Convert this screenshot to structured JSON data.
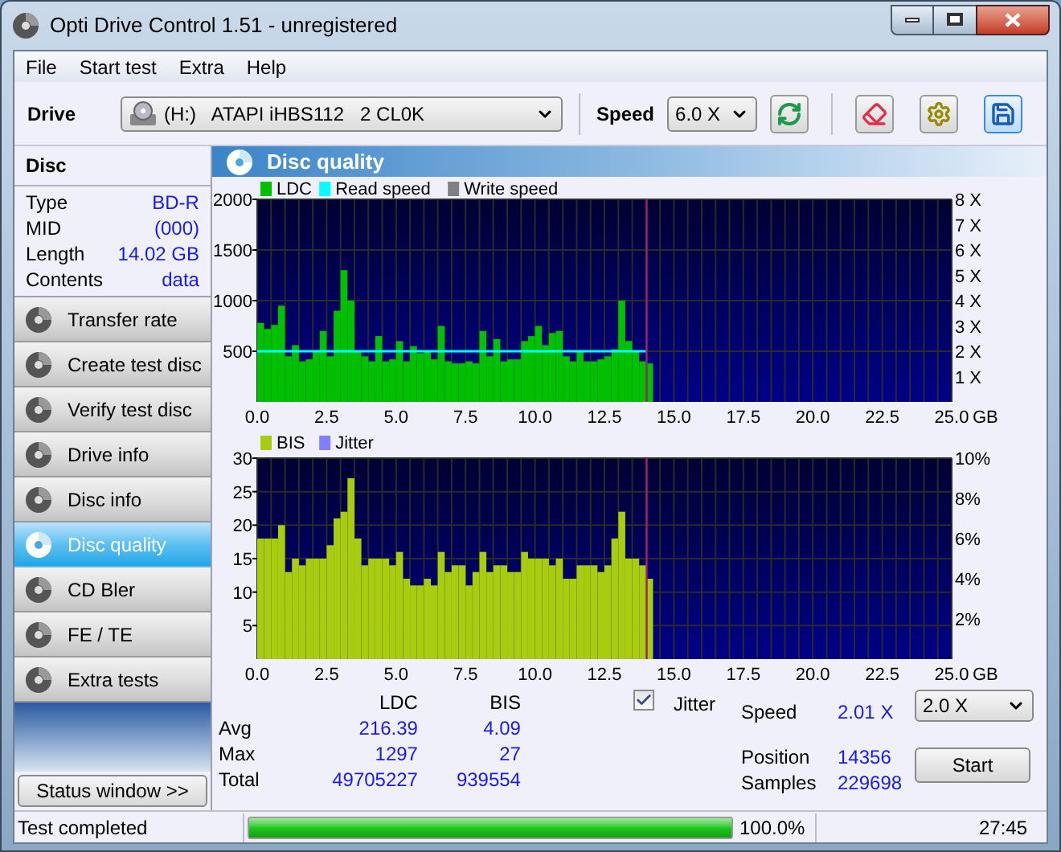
{
  "window": {
    "title": "Opti Drive Control 1.51 - unregistered"
  },
  "menu": [
    "File",
    "Start test",
    "Extra",
    "Help"
  ],
  "toolbar": {
    "drive_label": "Drive",
    "drive": "(H:)   ATAPI iHBS112   2 CL0K",
    "speed_label": "Speed",
    "speed": "6.0 X"
  },
  "disc": {
    "title": "Disc",
    "fields": [
      {
        "label": "Type",
        "value": "BD-R"
      },
      {
        "label": "MID",
        "value": "(000)"
      },
      {
        "label": "Length",
        "value": "14.02 GB"
      },
      {
        "label": "Contents",
        "value": "data"
      }
    ]
  },
  "nav": [
    {
      "label": "Transfer rate",
      "selected": false
    },
    {
      "label": "Create test disc",
      "selected": false
    },
    {
      "label": "Verify test disc",
      "selected": false
    },
    {
      "label": "Drive info",
      "selected": false
    },
    {
      "label": "Disc info",
      "selected": false
    },
    {
      "label": "Disc quality",
      "selected": true
    },
    {
      "label": "CD Bler",
      "selected": false
    },
    {
      "label": "FE / TE",
      "selected": false
    },
    {
      "label": "Extra tests",
      "selected": false
    }
  ],
  "status_window": "Status window >>",
  "panel": {
    "title": "Disc quality"
  },
  "charts": [
    {
      "legend": [
        {
          "label": "Write speed",
          "color": "#808080"
        }
      ],
      "chart_data": {
        "type": "bar",
        "grid": true,
        "legend": "top left",
        "xlabel": "GB",
        "xlim": [
          0,
          25
        ],
        "ylim": [
          0,
          2000
        ],
        "y2lim": [
          0,
          8
        ],
        "ref_lines": [
          {
            "axis": "x",
            "value": 14.02,
            "color": "#a0206a"
          }
        ],
        "xticks": [
          {
            "value": 0,
            "label": "0.0"
          },
          {
            "value": 2.5,
            "label": "2.5"
          },
          {
            "value": 5,
            "label": "5.0"
          },
          {
            "value": 7.5,
            "label": "7.5"
          },
          {
            "value": 10,
            "label": "10.0"
          },
          {
            "value": 12.5,
            "label": "12.5"
          },
          {
            "value": 15,
            "label": "15.0"
          },
          {
            "value": 17.5,
            "label": "17.5"
          },
          {
            "value": 20,
            "label": "20.0"
          },
          {
            "value": 22.5,
            "label": "22.5"
          },
          {
            "value": 25,
            "label": "25.0"
          }
        ],
        "yticks": [
          500,
          1000,
          1500,
          2000
        ],
        "y2ticks": [
          {
            "value": 1,
            "label": "1 X"
          },
          {
            "value": 2,
            "label": "2 X"
          },
          {
            "value": 3,
            "label": "3 X"
          },
          {
            "value": 4,
            "label": "4 X"
          },
          {
            "value": 5,
            "label": "5 X"
          },
          {
            "value": 6,
            "label": "6 X"
          },
          {
            "value": 7,
            "label": "7 X"
          },
          {
            "value": 8,
            "label": "8 X"
          }
        ],
        "x": [
          0,
          0.25,
          0.5,
          0.75,
          1,
          1.25,
          1.5,
          1.75,
          2,
          2.25,
          2.5,
          2.75,
          3,
          3.25,
          3.5,
          3.75,
          4,
          4.25,
          4.5,
          4.75,
          5,
          5.25,
          5.5,
          5.75,
          6,
          6.25,
          6.5,
          6.75,
          7,
          7.25,
          7.5,
          7.75,
          8,
          8.25,
          8.5,
          8.75,
          9,
          9.25,
          9.5,
          9.75,
          10,
          10.25,
          10.5,
          10.75,
          11,
          11.25,
          11.5,
          11.75,
          12,
          12.25,
          12.5,
          12.75,
          13,
          13.25,
          13.5,
          13.75,
          14
        ],
        "series": [
          {
            "name": "LDC",
            "color": "#00c000",
            "values": [
              780,
              720,
              760,
              950,
              450,
              560,
              400,
              420,
              500,
              700,
              450,
              900,
              1300,
              1000,
              500,
              450,
              400,
              650,
              400,
              420,
              600,
              400,
              550,
              480,
              500,
              420,
              750,
              400,
              380,
              380,
              400,
              380,
              700,
              450,
              620,
              400,
              420,
              420,
              600,
              650,
              750,
              560,
              680,
              700,
              450,
              400,
              500,
              400,
              400,
              420,
              450,
              520,
              1000,
              600,
              500,
              400,
              380
            ]
          },
          {
            "name": "Read speed",
            "color": "#00ffff",
            "type": "line",
            "axis": "y2",
            "values": [
              2,
              2,
              2,
              2,
              2,
              2,
              2,
              2,
              2,
              2,
              2,
              2,
              2,
              2,
              2,
              2,
              2,
              2,
              2,
              2,
              2,
              2,
              2,
              2,
              2,
              2,
              2,
              2,
              2,
              2,
              2,
              2,
              2,
              2,
              2,
              2,
              2,
              2,
              2,
              2,
              2,
              2,
              2,
              2,
              2,
              2,
              2,
              2,
              2,
              2,
              2,
              2,
              2,
              2,
              2,
              2,
              2
            ]
          }
        ]
      }
    },
    {
      "legend": [
        {
          "label": "Jitter",
          "color": "#8080ff"
        }
      ],
      "chart_data": {
        "type": "bar",
        "grid": true,
        "legend": "top left",
        "xlabel": "GB",
        "xlim": [
          0,
          25
        ],
        "ylim": [
          0,
          30
        ],
        "y2lim": [
          0,
          10
        ],
        "ref_lines": [
          {
            "axis": "x",
            "value": 14.02,
            "color": "#a0206a"
          }
        ],
        "xticks": [
          {
            "value": 0,
            "label": "0.0"
          },
          {
            "value": 2.5,
            "label": "2.5"
          },
          {
            "value": 5,
            "label": "5.0"
          },
          {
            "value": 7.5,
            "label": "7.5"
          },
          {
            "value": 10,
            "label": "10.0"
          },
          {
            "value": 12.5,
            "label": "12.5"
          },
          {
            "value": 15,
            "label": "15.0"
          },
          {
            "value": 17.5,
            "label": "17.5"
          },
          {
            "value": 20,
            "label": "20.0"
          },
          {
            "value": 22.5,
            "label": "22.5"
          },
          {
            "value": 25,
            "label": "25.0"
          }
        ],
        "yticks": [
          5,
          10,
          15,
          20,
          25,
          30
        ],
        "y2ticks": [
          {
            "value": 2,
            "label": "2%"
          },
          {
            "value": 4,
            "label": "4%"
          },
          {
            "value": 6,
            "label": "6%"
          },
          {
            "value": 8,
            "label": "8%"
          },
          {
            "value": 10,
            "label": "10%"
          }
        ],
        "x": [
          0,
          0.25,
          0.5,
          0.75,
          1,
          1.25,
          1.5,
          1.75,
          2,
          2.25,
          2.5,
          2.75,
          3,
          3.25,
          3.5,
          3.75,
          4,
          4.25,
          4.5,
          4.75,
          5,
          5.25,
          5.5,
          5.75,
          6,
          6.25,
          6.5,
          6.75,
          7,
          7.25,
          7.5,
          7.75,
          8,
          8.25,
          8.5,
          8.75,
          9,
          9.25,
          9.5,
          9.75,
          10,
          10.25,
          10.5,
          10.75,
          11,
          11.25,
          11.5,
          11.75,
          12,
          12.25,
          12.5,
          12.75,
          13,
          13.25,
          13.5,
          13.75,
          14
        ],
        "series": [
          {
            "name": "BIS",
            "color": "#a8cc10",
            "values": [
              18,
              18,
              18,
              20,
              13,
              15,
              14,
              15,
              15,
              15,
              17,
              21,
              22,
              27,
              18,
              14,
              15,
              15,
              15,
              14,
              16,
              12,
              11,
              11,
              12,
              11,
              16,
              13,
              14,
              14,
              11,
              13,
              16,
              13,
              14,
              14,
              13,
              13,
              16,
              15,
              15,
              15,
              14,
              15,
              12,
              12,
              14,
              14,
              14,
              13,
              14,
              18,
              22,
              15,
              15,
              14,
              12
            ]
          }
        ]
      }
    }
  ],
  "stats": {
    "columns": [
      "LDC",
      "BIS"
    ],
    "rows": [
      {
        "label": "Avg",
        "values": [
          "216.39",
          "4.09"
        ]
      },
      {
        "label": "Max",
        "values": [
          "1297",
          "27"
        ]
      },
      {
        "label": "Total",
        "values": [
          "49705227",
          "939554"
        ]
      }
    ]
  },
  "jitter": {
    "label": "Jitter",
    "checked": true
  },
  "readings": [
    {
      "label": "Speed",
      "value": "2.01 X"
    },
    {
      "label": "Position",
      "value": "14356"
    },
    {
      "label": "Samples",
      "value": "229698"
    }
  ],
  "speed_select": "2.0 X",
  "start": "Start",
  "status": {
    "text": "Test completed",
    "level": 1,
    "percent": "100.0%",
    "time": "27:45"
  }
}
